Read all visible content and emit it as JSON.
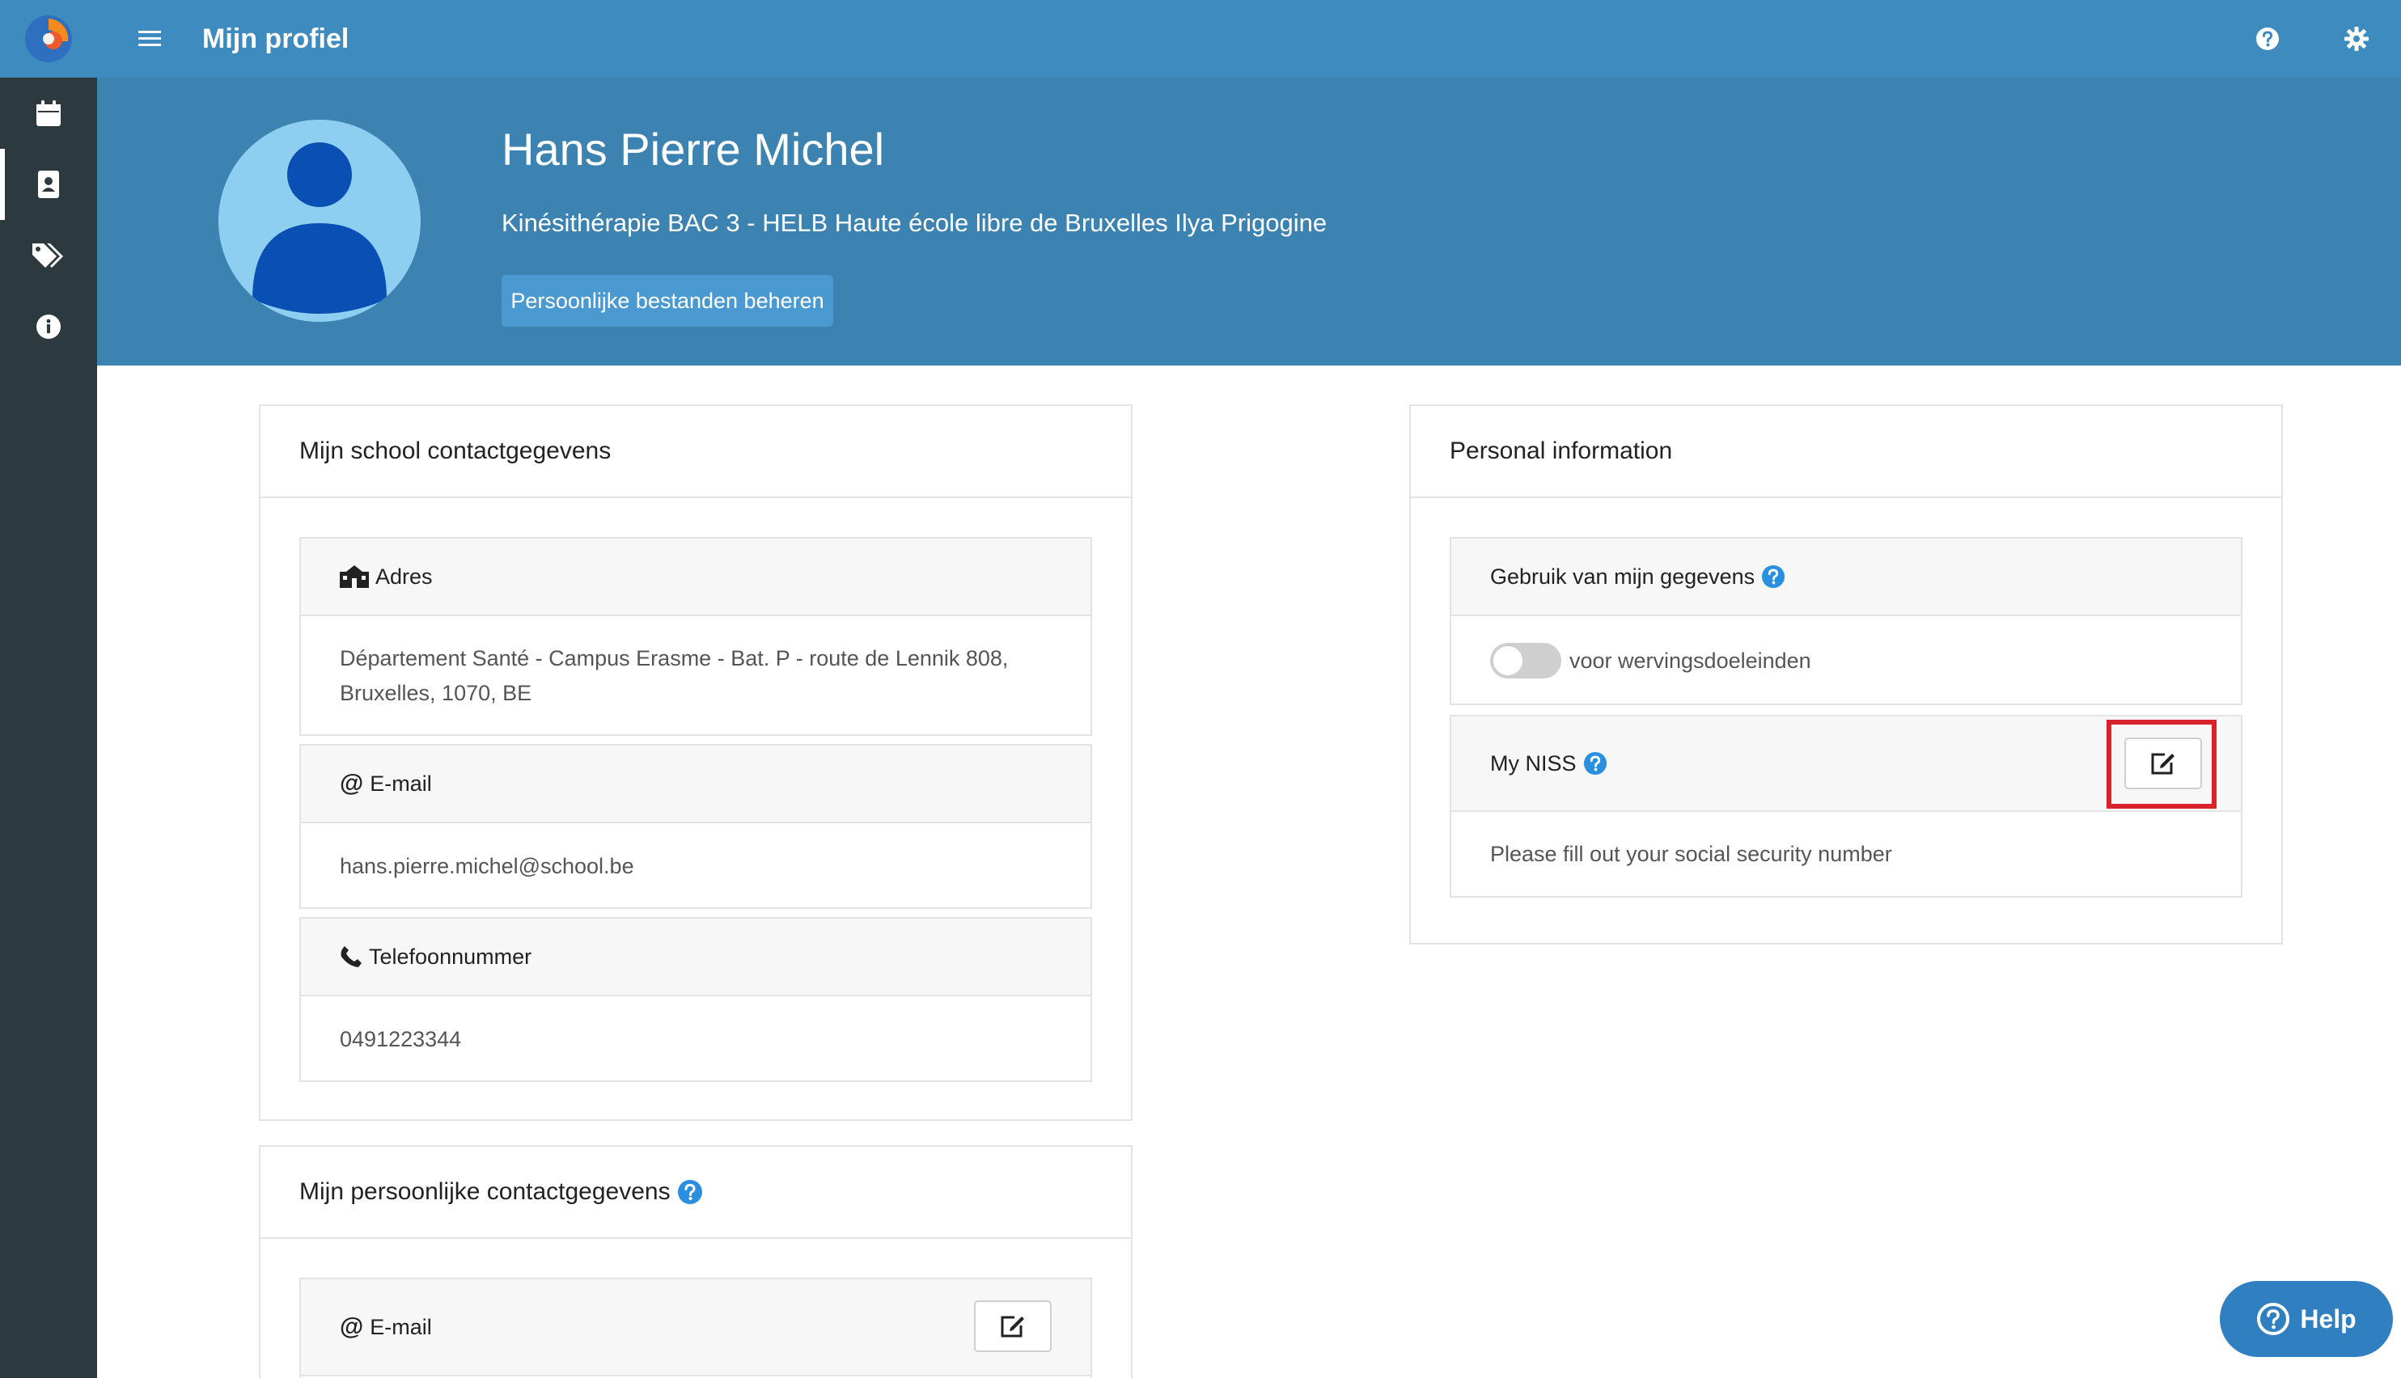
{
  "header": {
    "title": "Mijn profiel"
  },
  "profile": {
    "name": "Hans Pierre Michel",
    "program": "Kinésithérapie BAC 3 - HELB Haute école libre de Bruxelles Ilya Prigogine",
    "manage_files_label": "Persoonlijke bestanden beheren"
  },
  "school_contact": {
    "title": "Mijn school contactgegevens",
    "address_label": "Adres",
    "address_line1": "Département Santé - Campus Erasme - Bat. P - route de Lennik 808,",
    "address_line2": "Bruxelles, 1070, BE",
    "email_label": "E-mail",
    "email_value": "hans.pierre.michel@school.be",
    "phone_label": "Telefoonnummer",
    "phone_value": "0491223344"
  },
  "personal_contact": {
    "title": "Mijn persoonlijke contactgegevens",
    "email_label": "E-mail"
  },
  "personal_info": {
    "title": "Personal information",
    "data_usage_label": "Gebruik van mijn gegevens",
    "recruitment_label": "voor wervingsdoeleinden",
    "recruitment_enabled": false,
    "niss_label": "My NISS",
    "niss_hint": "Please fill out your social security number"
  },
  "help_button": {
    "label": "Help"
  },
  "colors": {
    "topbar": "#3d8bbf",
    "hero": "#3d83b2",
    "sidebar": "#2c3a3f",
    "highlight": "#d9222a",
    "help_blue": "#2f7fc1"
  }
}
